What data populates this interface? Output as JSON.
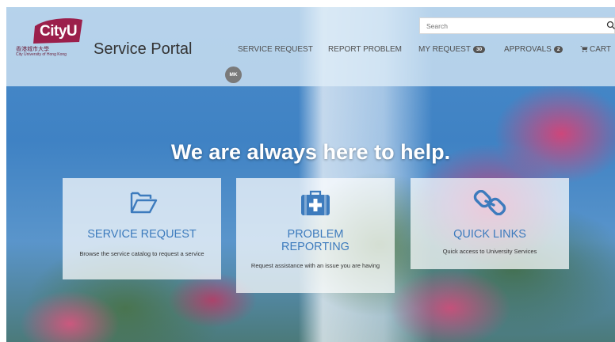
{
  "header": {
    "logo_text": "CityU",
    "logo_cn": "香港城市大學",
    "logo_en": "City University of Hong Kong",
    "portal_title": "Service Portal",
    "search_placeholder": "Search",
    "avatar_initials": "MK"
  },
  "nav": {
    "service_request": "SERVICE REQUEST",
    "report_problem": "REPORT PROBLEM",
    "my_request": "MY REQUEST",
    "my_request_count": "30",
    "approvals": "APPROVALS",
    "approvals_count": "2",
    "cart": "CART"
  },
  "hero": {
    "headline": "We are always here to help."
  },
  "cards": [
    {
      "icon": "folder-open-icon",
      "title": "SERVICE REQUEST",
      "description": "Browse the service catalog to request a service"
    },
    {
      "icon": "medkit-icon",
      "title_line1": "PROBLEM",
      "title_line2": "REPORTING",
      "description": "Request assistance with an issue you are having"
    },
    {
      "icon": "link-icon",
      "title": "QUICK LINKS",
      "description": "Quick access to University Services"
    }
  ],
  "colors": {
    "accent": "#3d7bbd",
    "logo": "#9b1f4b",
    "badge": "#555555"
  }
}
